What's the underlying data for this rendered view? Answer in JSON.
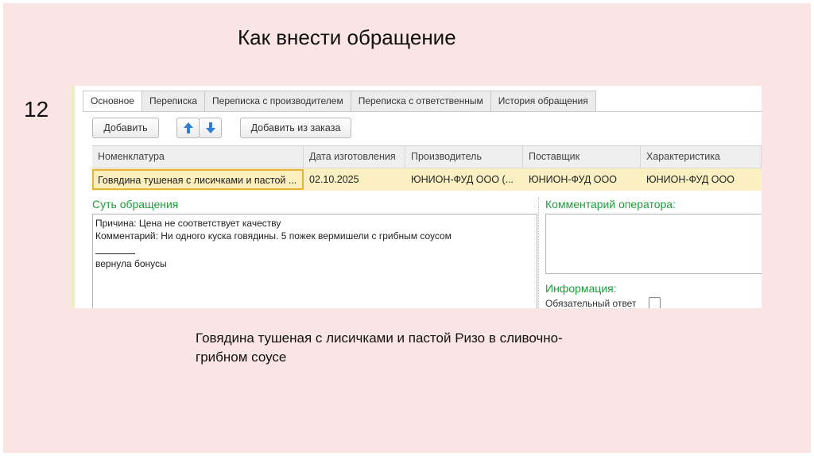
{
  "slide": {
    "title": "Как внести обращение",
    "number": "12",
    "caption": "Говядина тушеная с лисичками и пастой Ризо в сливочно-грибном соусе"
  },
  "tabs": [
    {
      "label": "Основное",
      "active": true
    },
    {
      "label": "Переписка",
      "active": false
    },
    {
      "label": "Переписка с производителем",
      "active": false
    },
    {
      "label": "Переписка с ответственным",
      "active": false
    },
    {
      "label": "История обращения",
      "active": false
    }
  ],
  "toolbar": {
    "add_label": "Добавить",
    "up_icon": "arrow-up-icon",
    "down_icon": "arrow-down-icon",
    "add_from_order_label": "Добавить из заказа"
  },
  "grid": {
    "columns": [
      "Номенклатура",
      "Дата изготовления",
      "Производитель",
      "Поставщик",
      "Характеристика"
    ],
    "rows": [
      [
        "Говядина тушеная с лисичками и пастой ...",
        "02.10.2025",
        "ЮНИОН-ФУД ООО (...",
        "ЮНИОН-ФУД ООО",
        "ЮНИОН-ФУД ООО"
      ]
    ]
  },
  "essence": {
    "title": "Суть обращения",
    "lines": [
      "Причина: Цена не соответствует качеству",
      "Комментарий: Ни одного куска говядины. 5 пожек вермишели с грибным соусом",
      "вернула бонусы"
    ]
  },
  "operator": {
    "title": "Комментарий оператора:"
  },
  "info": {
    "title": "Информация:",
    "required_reply_label": "Обязательный ответ"
  },
  "colors": {
    "slide_bg": "#fbe4e4",
    "section_title": "#1e9e3c",
    "selected_row": "#fbf0c2",
    "focus_border": "#e7b437",
    "arrow_blue": "#2f7fd6"
  }
}
